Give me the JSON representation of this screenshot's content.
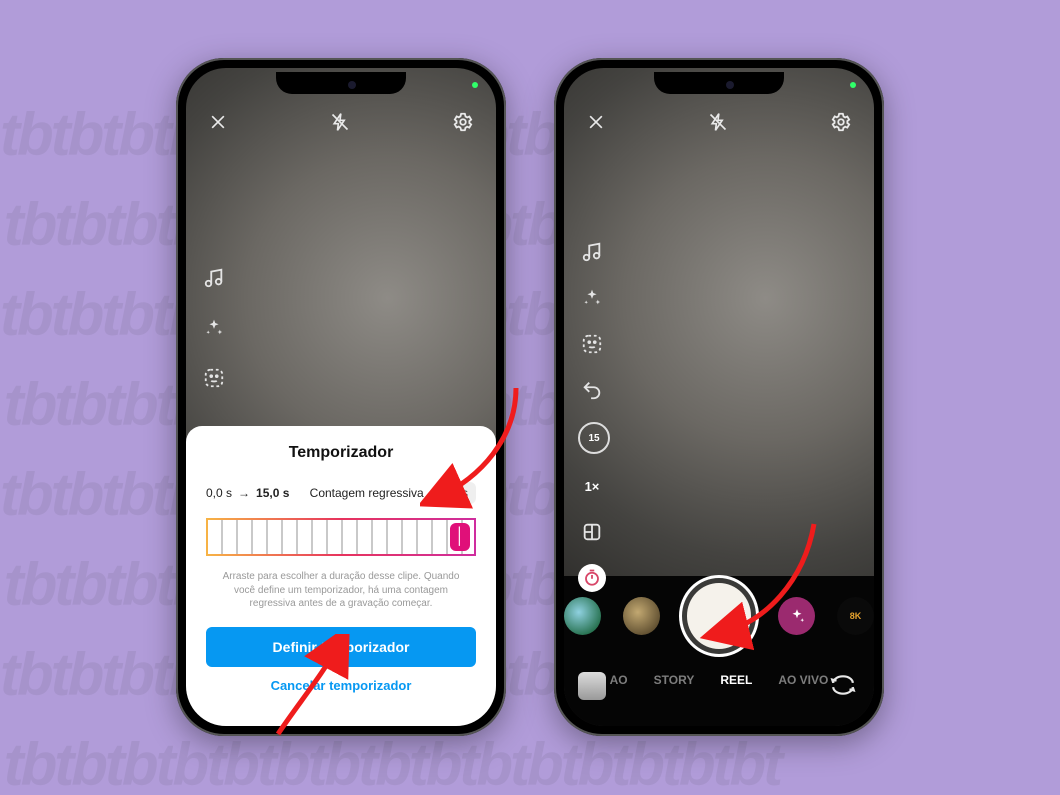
{
  "sheet": {
    "title": "Temporizador",
    "range_start": "0,0 s",
    "range_end": "15,0 s",
    "countdown_label": "Contagem regressiva",
    "countdown_value": "3 s",
    "help": "Arraste para escolher a duração desse clipe. Quando você define um temporizador, há uma contagem regressiva antes de a gravação começar.",
    "primary": "Definir temporizador",
    "cancel": "Cancelar temporizador"
  },
  "right": {
    "duration_badge": "15",
    "zoom": "1×",
    "8k": "8K",
    "modes": {
      "story": "STORY",
      "reel": "REEL",
      "live": "AO VIVO",
      "ao": "AO"
    }
  },
  "watermark": "tbtbtbtbtbtbtbtbtbtbt"
}
